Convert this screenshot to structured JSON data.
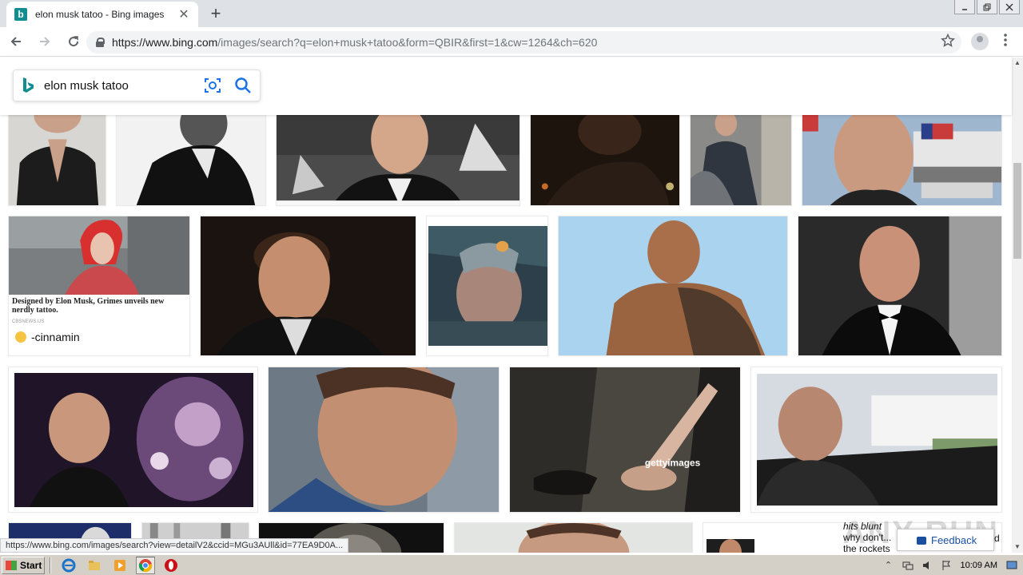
{
  "browser": {
    "tab_title": "elon musk tatoo - Bing images",
    "tab_close": "✕",
    "new_tab": "+",
    "url_host": "https://www.bing.com",
    "url_path": "/images/search?q=elon+musk+tatoo&form=QBIR&first=1&cw=1264&ch=620",
    "status_url": "https://www.bing.com/images/search?view=detailV2&ccid=MGu3AUll&id=77EA9D0A..."
  },
  "search": {
    "query": "elon musk tatoo"
  },
  "results": {
    "grimes_caption": "Designed by Elon Musk, Grimes unveils new nerdly tattoo.",
    "grimes_source": "CBSNEWS.US",
    "grimes_user": "-cinnamin",
    "hits_caption_line1": "hits blunt",
    "hits_caption_line2": "why don't...",
    "hits_caption_line3": "the rockets",
    "hits_caption_suffix": "d",
    "watermark": "ANY RUN"
  },
  "feedback": {
    "label": "Feedback"
  },
  "taskbar": {
    "start_label": "Start",
    "clock": "10:09 AM"
  },
  "colors": {
    "bing_teal": "#138d90",
    "search_icon_blue": "#1a73e8",
    "feedback_blue": "#1a4fa0"
  }
}
